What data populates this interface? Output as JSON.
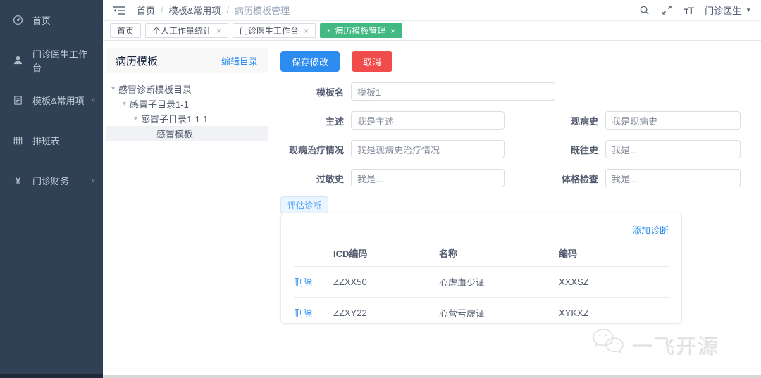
{
  "icons": {
    "close": "×",
    "caret": "▾",
    "chevron": "∨",
    "active_dot": "●",
    "dropdown_caret": "▼",
    "yen": "¥",
    "breadcrumb_sep": "/",
    "font_resize": "тT"
  },
  "sidebar": {
    "items": [
      {
        "label": "首页"
      },
      {
        "label": "门诊医生工作台"
      },
      {
        "label": "模板&常用项"
      },
      {
        "label": "排班表"
      },
      {
        "label": "门诊财务"
      }
    ]
  },
  "header": {
    "breadcrumb": {
      "home": "首页",
      "section": "模板&常用项",
      "current": "病历模板管理"
    },
    "user_name": "门诊医生"
  },
  "tabs": {
    "items": [
      {
        "label": "首页"
      },
      {
        "label": "个人工作量统计"
      },
      {
        "label": "门诊医生工作台"
      },
      {
        "label": "病历模板管理"
      }
    ]
  },
  "panel": {
    "title": "病历模板",
    "edit_link": "编辑目录",
    "tree": [
      {
        "label": "感冒诊断模板目录"
      },
      {
        "label": "感冒子目录1-1"
      },
      {
        "label": "感冒子目录1-1-1"
      },
      {
        "label": "感冒模板"
      }
    ]
  },
  "form": {
    "save_label": "保存修改",
    "cancel_label": "取消",
    "template_name": {
      "label": "模板名",
      "value": "模板1"
    },
    "chief_complaint": {
      "label": "主述",
      "value": "我是主述"
    },
    "present_illness": {
      "label": "现病史",
      "value": "我是现病史"
    },
    "present_treatment": {
      "label": "现病治疗情况",
      "value": "我是现病史治疗情况"
    },
    "past_history": {
      "label": "既往史",
      "value": "我是..."
    },
    "allergy_history": {
      "label": "过敏史",
      "value": "我是..."
    },
    "physical_exam": {
      "label": "体格检查",
      "value": "我是..."
    }
  },
  "diagnosis": {
    "tab_label": "评估诊断",
    "add_link": "添加诊断",
    "delete_label": "删除",
    "columns": {
      "icd": "ICD编码",
      "name": "名称",
      "code": "编码"
    },
    "rows": [
      {
        "icd": "ZZXX50",
        "name": "心虚血少证",
        "code": "XXXSZ"
      },
      {
        "icd": "ZZXY22",
        "name": "心营亏虚证",
        "code": "XYKXZ"
      }
    ]
  },
  "watermark": {
    "text": "一飞开源"
  },
  "colors": {
    "accent_blue": "#2d8cf0",
    "danger_red": "#f04c4c",
    "active_green": "#42b983",
    "sidebar_bg": "#304156"
  }
}
